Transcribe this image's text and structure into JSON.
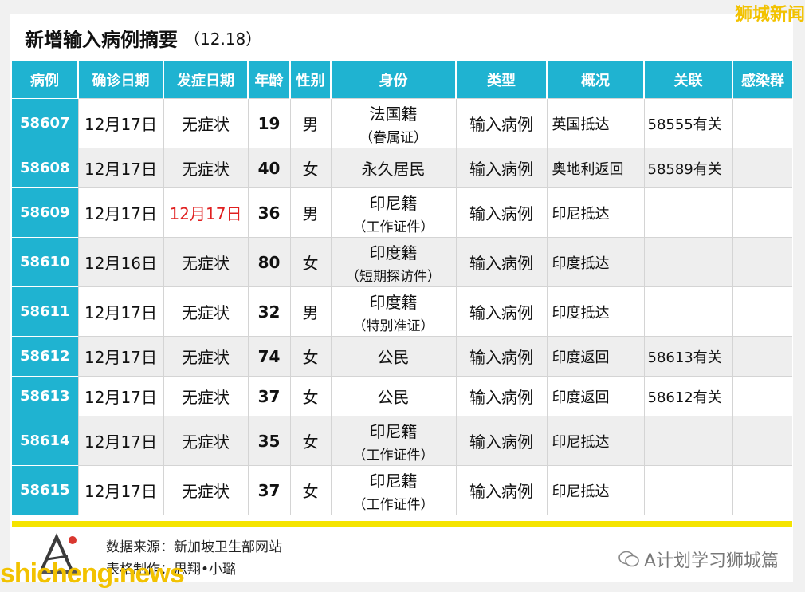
{
  "header": {
    "title": "新增输入病例摘要",
    "date": "（12.18）",
    "brand": "狮城新闻"
  },
  "columns": [
    "病例",
    "确诊日期",
    "发症日期",
    "年龄",
    "性别",
    "身份",
    "类型",
    "概况",
    "关联",
    "感染群"
  ],
  "rows": [
    {
      "case": "58607",
      "confirmed": "12月17日",
      "onset": "无症状",
      "age": "19",
      "sex": "男",
      "identity": "法国籍",
      "identity_sub": "（眷属证）",
      "type": "输入病例",
      "summary": "英国抵达",
      "link": "58555有关",
      "cluster": ""
    },
    {
      "case": "58608",
      "confirmed": "12月17日",
      "onset": "无症状",
      "age": "40",
      "sex": "女",
      "identity": "永久居民",
      "identity_sub": "",
      "type": "输入病例",
      "summary": "奥地利返回",
      "link": "58589有关",
      "cluster": ""
    },
    {
      "case": "58609",
      "confirmed": "12月17日",
      "onset": "12月17日",
      "age": "36",
      "sex": "男",
      "identity": "印尼籍",
      "identity_sub": "（工作证件）",
      "type": "输入病例",
      "summary": "印尼抵达",
      "link": "",
      "cluster": ""
    },
    {
      "case": "58610",
      "confirmed": "12月16日",
      "onset": "无症状",
      "age": "80",
      "sex": "女",
      "identity": "印度籍",
      "identity_sub": "（短期探访件）",
      "type": "输入病例",
      "summary": "印度抵达",
      "link": "",
      "cluster": ""
    },
    {
      "case": "58611",
      "confirmed": "12月17日",
      "onset": "无症状",
      "age": "32",
      "sex": "男",
      "identity": "印度籍",
      "identity_sub": "（特别准证）",
      "type": "输入病例",
      "summary": "印度抵达",
      "link": "",
      "cluster": ""
    },
    {
      "case": "58612",
      "confirmed": "12月17日",
      "onset": "无症状",
      "age": "74",
      "sex": "女",
      "identity": "公民",
      "identity_sub": "",
      "type": "输入病例",
      "summary": "印度返回",
      "link": "58613有关",
      "cluster": ""
    },
    {
      "case": "58613",
      "confirmed": "12月17日",
      "onset": "无症状",
      "age": "37",
      "sex": "女",
      "identity": "公民",
      "identity_sub": "",
      "type": "输入病例",
      "summary": "印度返回",
      "link": "58612有关",
      "cluster": ""
    },
    {
      "case": "58614",
      "confirmed": "12月17日",
      "onset": "无症状",
      "age": "35",
      "sex": "女",
      "identity": "印尼籍",
      "identity_sub": "（工作证件）",
      "type": "输入病例",
      "summary": "印尼抵达",
      "link": "",
      "cluster": ""
    },
    {
      "case": "58615",
      "confirmed": "12月17日",
      "onset": "无症状",
      "age": "37",
      "sex": "女",
      "identity": "印尼籍",
      "identity_sub": "（工作证件）",
      "type": "输入病例",
      "summary": "印尼抵达",
      "link": "",
      "cluster": ""
    }
  ],
  "footer": {
    "source": "数据来源：新加坡卫生部网站",
    "credit": "表格制作：思翔•小璐",
    "wechat": "A计划学习狮城篇",
    "watermark": "shicheng.news"
  },
  "colors": {
    "header_bg": "#1fb3d1",
    "highlight_red": "#e02020",
    "brand_yellow": "#f2c200",
    "accent_line": "#f5e400"
  }
}
